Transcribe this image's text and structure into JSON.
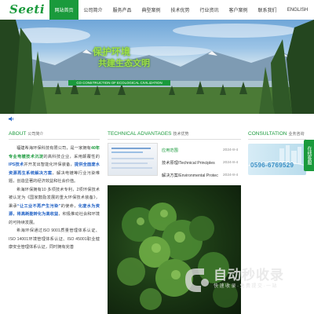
{
  "header": {
    "logo_text": "Seeti",
    "nav": [
      {
        "label": "网站首页",
        "active": true
      },
      {
        "label": "公司简介",
        "active": false
      },
      {
        "label": "服务产品",
        "active": false
      },
      {
        "label": "典型案例",
        "active": false
      },
      {
        "label": "技术优势",
        "active": false
      },
      {
        "label": "行业资讯",
        "active": false
      },
      {
        "label": "客户案例",
        "active": false
      },
      {
        "label": "联系我们",
        "active": false
      },
      {
        "label": "ENGLISH",
        "active": false
      }
    ]
  },
  "banner": {
    "title": "保护环境",
    "subtitle": "共建生态文明",
    "strip": "CO CONSTRUCTION OF ECOLOGICAL CIVILIZATION"
  },
  "about": {
    "title": "ABOUT",
    "subtitle": "公司简介",
    "p1_a": "福建希海环保科技有限公司，是一家拥有",
    "p1_hl1": "40年专业电镀技术沉淀",
    "p1_b": "的高科技企业，采用",
    "p1_c": "颠覆性的",
    "p1_hl2": "IPS技术",
    "p1_d": "并开发",
    "p1_e": "出智能化环保装备，",
    "p1_hl3": "提供全面废水资源再生系统解决方案",
    "p1_f": "，解决电镀等行业污染难题，创造显著的经济效益和社会价值。",
    "p2_a": "希海环保拥有10 多项技术专利，2项环保技术被认定为《国家鼓励发展的重大环保技术装备》，秉承",
    "p2_hl1": "“让工业不再产生污染”",
    "p2_b": "的使命，",
    "p2_hl2": "化废水为资源，将高耗能转化为高收益",
    "p2_c": "，积极推动社会和环境的可持续发展。",
    "p3": "希海环保通过ISO 9001质量管理体系认证、ISO 14001环境管理体系认证、ISO 45001职业健康安全管理体系认证，同时拥有完善"
  },
  "tech": {
    "title": "TECHNICAL ADVANTAGES",
    "subtitle": "技术优势",
    "rows": [
      {
        "title": "应用范围",
        "date": "2024-8-4"
      },
      {
        "title": "技术原理/Technical Principles",
        "date": "2024-8-4"
      },
      {
        "title": "解决方案/Environmental Protecti...",
        "date": "2024-8-4"
      }
    ]
  },
  "consult": {
    "title": "CONSULTATION",
    "subtitle": "业务咨询",
    "phone": "0596-6769529"
  },
  "side_float": {
    "label": "在线客服"
  },
  "watermark": {
    "title": "自动秒收录",
    "sub": "快速收录·免费提交·一站"
  },
  "colors": {
    "brand": "#1a9a3c",
    "text": "#444444",
    "highlight_blue": "#1e5fc4"
  }
}
